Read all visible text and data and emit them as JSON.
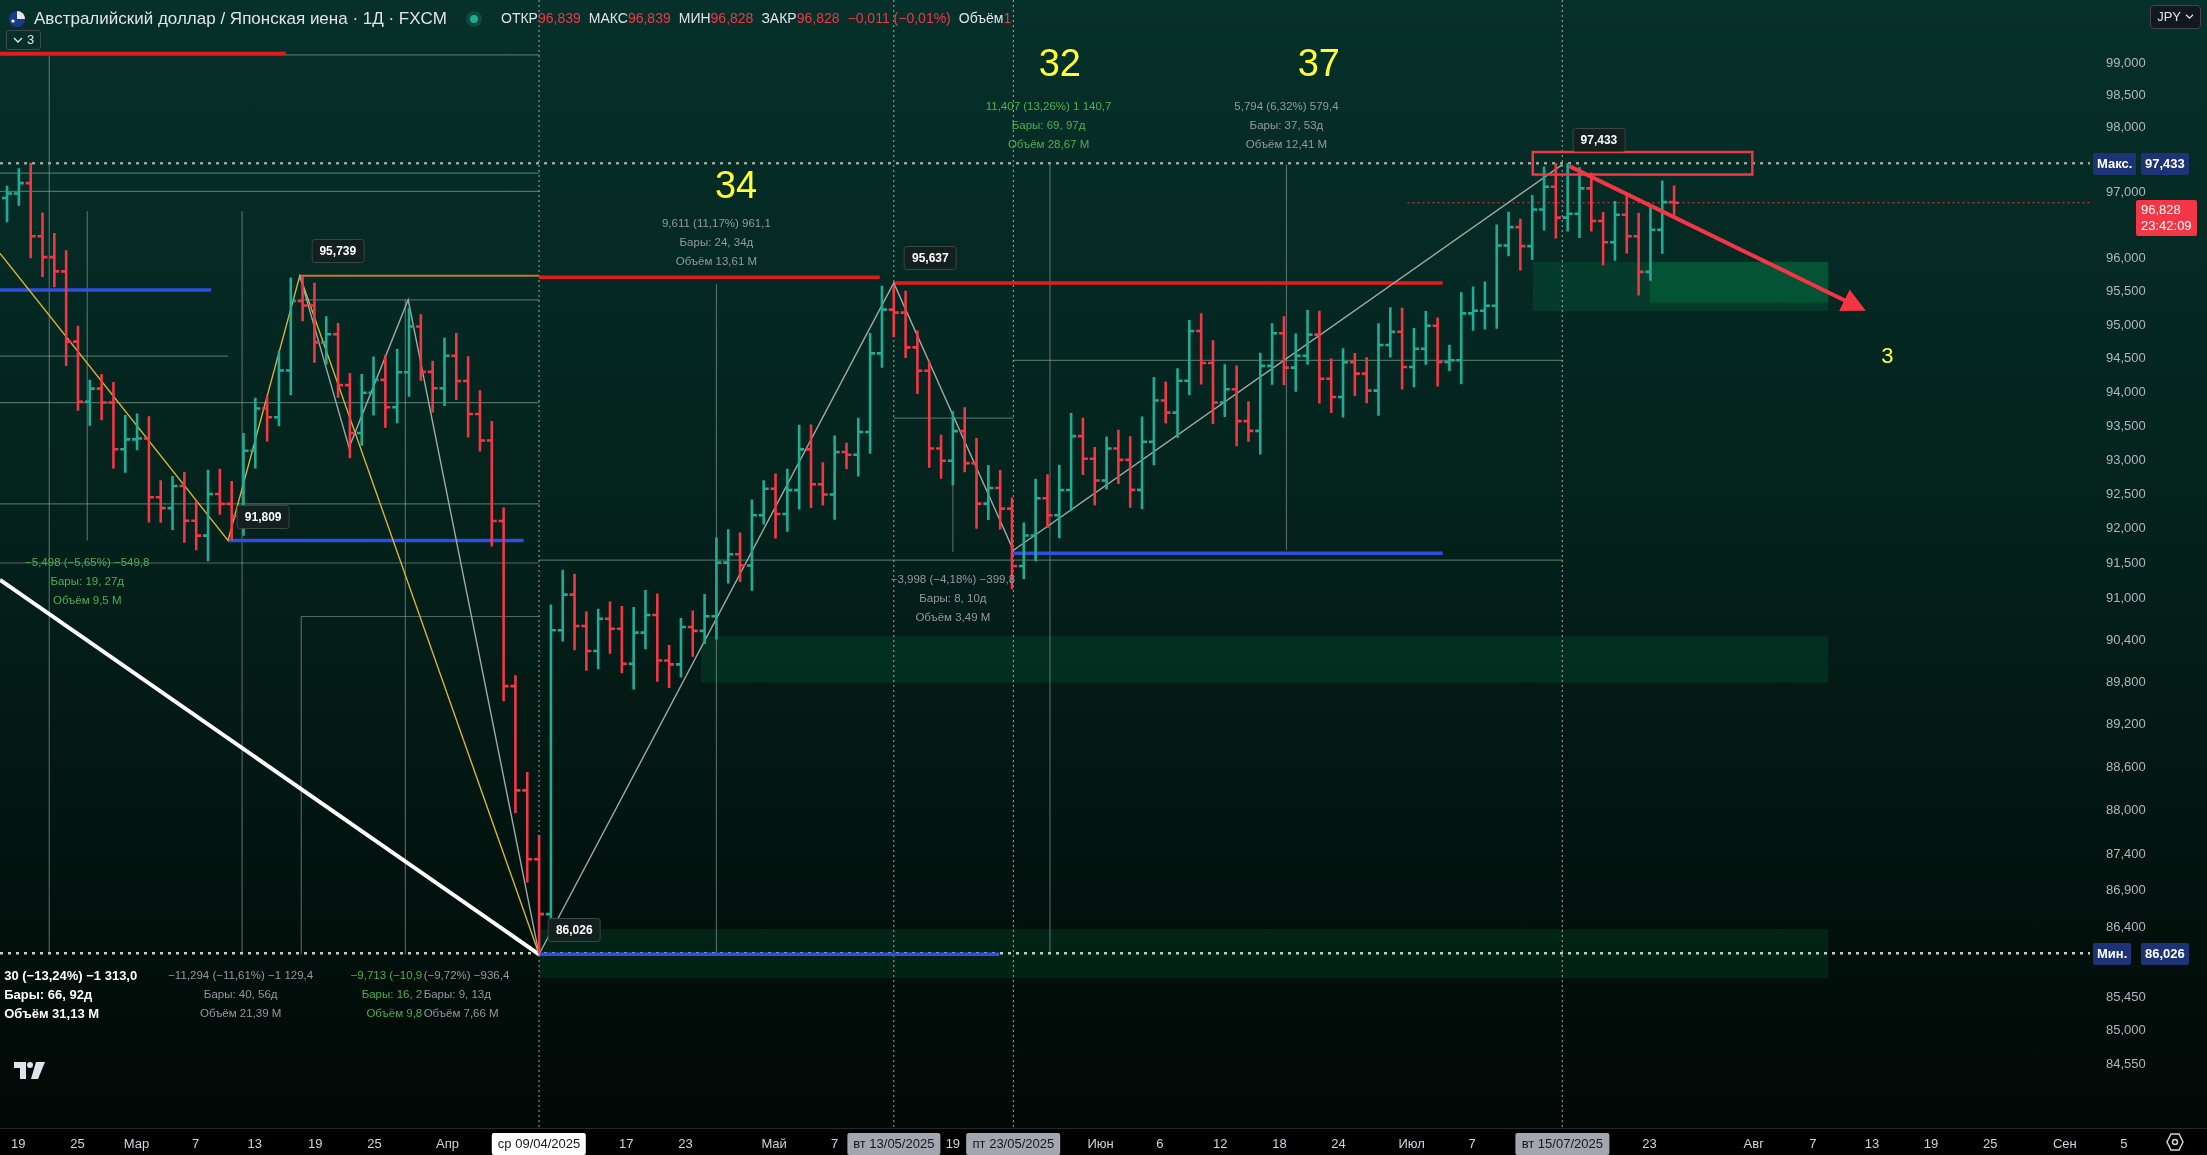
{
  "header": {
    "symbol": "Австралийский доллар / Японская иена · 1Д · FXCM",
    "ohlc": [
      {
        "label": "ОТКР",
        "value": "96,839"
      },
      {
        "label": "МАКС",
        "value": "96,839"
      },
      {
        "label": "МИН",
        "value": "96,828"
      },
      {
        "label": "ЗАКР",
        "value": "96,828"
      }
    ],
    "change": "−0,011 (−0,01%)",
    "volume_label": "Объём",
    "volume": "1"
  },
  "indicators_toggle": {
    "count": "3"
  },
  "currency_button": {
    "label": "JPY"
  },
  "annotations": {
    "wave_counts": [
      "34",
      "32",
      "37",
      "3"
    ],
    "price_labels": [
      "95,739",
      "91,809",
      "95,637",
      "86,026",
      "97,433"
    ],
    "measurements": [
      {
        "color": "#9598a1",
        "lines": [
          "9,611 (11,17%) 961,1",
          "Бары: 24, 34д",
          "Объём 13,61 M"
        ]
      },
      {
        "color": "#4caf50",
        "lines": [
          "11,407 (13,26%) 1 140,7",
          "Бары: 69, 97д",
          "Объём 28,67 M"
        ]
      },
      {
        "color": "#9598a1",
        "lines": [
          "5,794 (6,32%) 579,4",
          "Бары: 37, 53д",
          "Объём 12,41 M"
        ]
      },
      {
        "color": "#9598a1",
        "lines": [
          "−3,998 (−4,18%) −399,8",
          "Бары: 8, 10д",
          "Объём 3,49 M"
        ]
      },
      {
        "color": "#4caf50",
        "lines": [
          "−5,498 (−5,65%) −549,8",
          "Бары: 19, 27д",
          "Объём 9,5 M"
        ]
      },
      {
        "color": "#ffffff",
        "lines": [
          "30 (−13,24%) −1 313,0",
          "Бары: 66, 92д",
          "Объём 31,13 M"
        ]
      },
      {
        "color": "#9598a1",
        "lines": [
          "−11,294 (−11,61%) −1 129,4",
          "Бары: 40, 56д",
          "Объём 21,39 M"
        ]
      },
      {
        "color": "#4caf50",
        "lines": [
          "−9,713 (−10,9",
          "Бары: 16, 2",
          "Объём 9,8"
        ]
      },
      {
        "color": "#9598a1",
        "lines": [
          "(−9,72%) −936,4",
          "Бары: 9, 13д",
          "Объём 7,66 M"
        ]
      }
    ]
  },
  "price_axis": {
    "ticks": [
      "99,000",
      "98,500",
      "98,000",
      "97,000",
      "96,000",
      "95,500",
      "95,000",
      "94,500",
      "94,000",
      "93,500",
      "93,000",
      "92,500",
      "92,000",
      "91,500",
      "91,000",
      "90,400",
      "89,800",
      "89,200",
      "88,600",
      "88,000",
      "87,400",
      "86,900",
      "86,400",
      "85,450",
      "85,000",
      "84,550"
    ],
    "markers": [
      {
        "kind": "max",
        "label": "Макс.",
        "value": "97,433"
      },
      {
        "kind": "last",
        "value": "96,828",
        "countdown": "23:42:09"
      },
      {
        "kind": "min",
        "label": "Мин.",
        "value": "86,026"
      }
    ]
  },
  "time_axis": {
    "labels": [
      {
        "kind": "tick",
        "text": "19"
      },
      {
        "kind": "tick",
        "text": "25"
      },
      {
        "kind": "tick",
        "text": "Мар"
      },
      {
        "kind": "tick",
        "text": "7"
      },
      {
        "kind": "tick",
        "text": "13"
      },
      {
        "kind": "tick",
        "text": "19"
      },
      {
        "kind": "tick",
        "text": "25"
      },
      {
        "kind": "tick",
        "text": "Апр"
      },
      {
        "kind": "cursor",
        "text": "ср 09/04/2025"
      },
      {
        "kind": "tick",
        "text": "17"
      },
      {
        "kind": "tick",
        "text": "23"
      },
      {
        "kind": "tick",
        "text": "Май"
      },
      {
        "kind": "tick",
        "text": "7"
      },
      {
        "kind": "marker",
        "text": "вт 13/05/2025"
      },
      {
        "kind": "tick",
        "text": "19"
      },
      {
        "kind": "marker",
        "text": "пт 23/05/2025"
      },
      {
        "kind": "tick",
        "text": "Июн"
      },
      {
        "kind": "tick",
        "text": "6"
      },
      {
        "kind": "tick",
        "text": "12"
      },
      {
        "kind": "tick",
        "text": "18"
      },
      {
        "kind": "tick",
        "text": "24"
      },
      {
        "kind": "tick",
        "text": "Июл"
      },
      {
        "kind": "tick",
        "text": "7"
      },
      {
        "kind": "marker",
        "text": "вт 15/07/2025"
      },
      {
        "kind": "tick",
        "text": "23"
      },
      {
        "kind": "tick",
        "text": "Авг"
      },
      {
        "kind": "tick",
        "text": "7"
      },
      {
        "kind": "tick",
        "text": "13"
      },
      {
        "kind": "tick",
        "text": "19"
      },
      {
        "kind": "tick",
        "text": "25"
      },
      {
        "kind": "tick",
        "text": "Сен"
      },
      {
        "kind": "tick",
        "text": "5"
      }
    ]
  }
}
